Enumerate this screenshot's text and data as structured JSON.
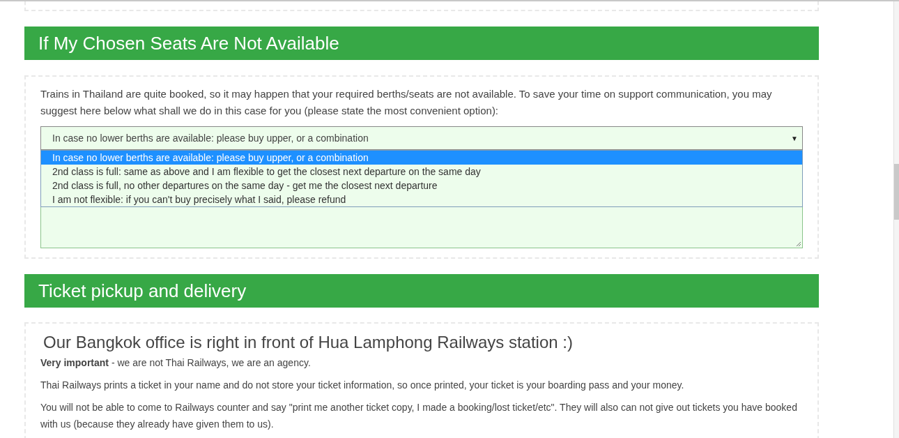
{
  "sections": [
    {
      "kind": "form",
      "title": "If My Chosen Seats Are Not Available",
      "intro": "Trains in Thailand are quite booked, so it may happen that your required berths/seats are not available. To save your time on support communication, you may suggest here below what shall we do in this case for you (please state the most convenient option):",
      "select": {
        "value": "In case no lower berths are available: please buy upper, or a combination",
        "arrow": "▼",
        "expanded": true,
        "options": [
          {
            "label": "In case no lower berths are available: please buy upper, or a combination",
            "selected": true
          },
          {
            "label": "2nd class is full: same as above and I am flexible to get the closest next departure on the same day",
            "selected": false
          },
          {
            "label": "2nd class is full, no other departures on the same day - get me the closest next departure",
            "selected": false
          },
          {
            "label": "I am not flexible: if you can't buy precisely what I said, please refund",
            "selected": false
          }
        ]
      }
    },
    {
      "kind": "info",
      "title": "Ticket pickup and delivery",
      "subtitle": "Our Bangkok office is right in front of Hua Lamphong Railways station :)",
      "paragraphs": [
        "**Very important** - we are not Thai Railways, we are an agency.",
        "Thai Railways prints a ticket in your name and do not store your ticket information, so once printed, your ticket is your boarding pass and your money.",
        "You will not be able to come to Railways counter and say \"print me another ticket copy, I made a booking/lost ticket/etc\". They will also can not give out tickets you have booked with us (because they already have given them to us)."
      ]
    }
  ]
}
